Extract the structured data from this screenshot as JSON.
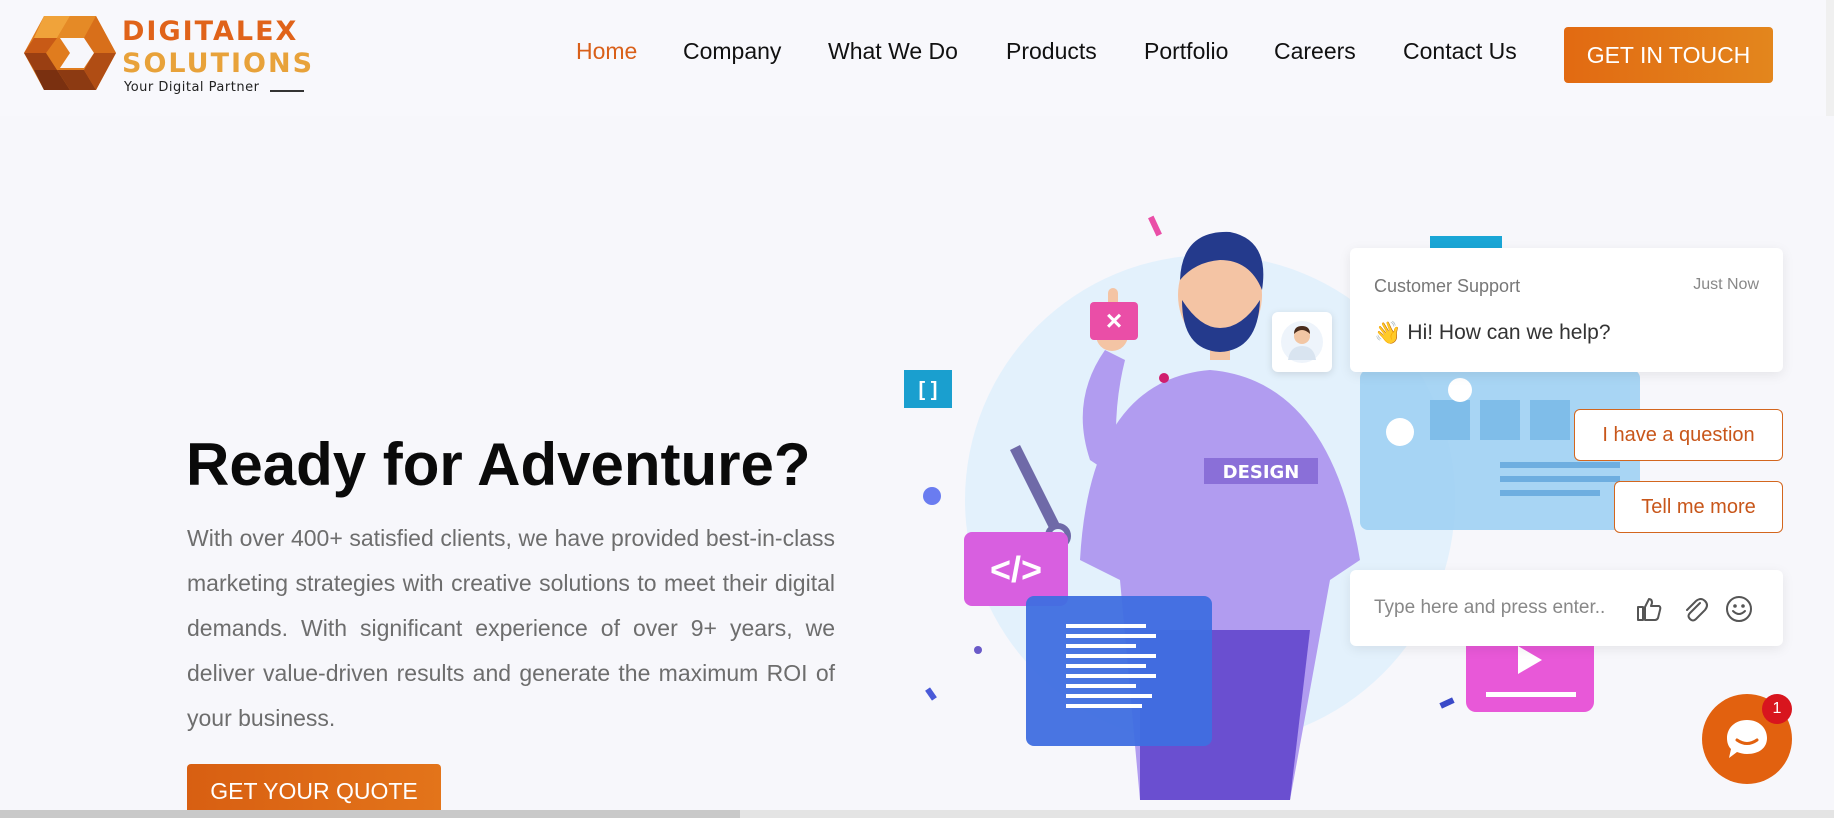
{
  "brand": {
    "name_line1": "DIGITALEX",
    "name_line2": "SOLUTIONS",
    "tagline": "Your Digital Partner",
    "colors": {
      "primary": "#e0631a",
      "secondary": "#e8a23a"
    }
  },
  "nav": {
    "items": [
      {
        "label": "Home",
        "active": true
      },
      {
        "label": "Company"
      },
      {
        "label": "What We Do"
      },
      {
        "label": "Products"
      },
      {
        "label": "Portfolio"
      },
      {
        "label": "Careers"
      },
      {
        "label": "Contact Us"
      }
    ],
    "cta_label": "GET IN TOUCH"
  },
  "hero": {
    "title": "Ready for Adventure?",
    "text": "With over 400+ satisfied clients, we have provided best-in-class marketing strategies with creative solutions to meet their digital demands. With significant experience of over 9+ years, we deliver value-driven results and generate the maximum ROI of your business.",
    "cta_label": "GET YOUR QUOTE",
    "illustration_badge": "DESIGN"
  },
  "chat": {
    "agent_name": "Customer Support",
    "time": "Just Now",
    "wave_icon": "👋",
    "message": "Hi! How can we help?",
    "quick_replies": [
      "I have a question",
      "Tell me more"
    ],
    "input_placeholder": "Type here and press enter..",
    "launcher_badge": "1",
    "icons": [
      "thumbs-up-icon",
      "paperclip-icon",
      "smiley-icon"
    ]
  }
}
